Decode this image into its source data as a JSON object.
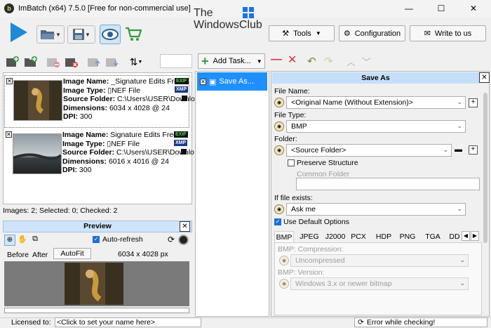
{
  "window": {
    "title": "ImBatch (x64) 7.5.0 [Free for non-commercial use]",
    "minimize": "—",
    "maximize": "☐",
    "close": "✕"
  },
  "watermark": {
    "line1": "The",
    "line2": "WindowsClub"
  },
  "toolbar": {
    "tools_label": "Tools",
    "configuration_label": "Configuration",
    "write_label": "Write to us"
  },
  "images": [
    {
      "name_label": "Image Name:",
      "name": "_Signature Edits Free",
      "type_label": "Image Type:",
      "type": "NEF File",
      "folder_label": "Source Folder:",
      "folder": "C:\\Users\\USER\\Downlo",
      "dim_label": "Dimensions:",
      "dim": "6034 x 4028 @ 24",
      "dpi_label": "DPI:",
      "dpi": "300"
    },
    {
      "name_label": "Image Name:",
      "name": "Signature Edits Free",
      "type_label": "Image Type:",
      "type": "NEF File",
      "folder_label": "Source Folder:",
      "folder": "C:\\Users\\USER\\Downlo",
      "dim_label": "Dimensions:",
      "dim": "6016 x 4016 @ 24",
      "dpi_label": "DPI:",
      "dpi": "300"
    }
  ],
  "badges": {
    "exif": "EXIF",
    "xmp": "XMP"
  },
  "status": "Images: 2; Selected: 0; Checked: 2",
  "preview": {
    "title": "Preview",
    "autorefresh": "Auto-refresh",
    "before": "Before",
    "after": "After",
    "autofit": "AutoFit",
    "size": "6034 x 4028 px"
  },
  "tasks": {
    "add_task": "Add Task...",
    "item": "Save As..."
  },
  "saveas": {
    "title": "Save As",
    "filename_label": "File Name:",
    "filename_value": "<Original Name (Without Extension)>",
    "filetype_label": "File Type:",
    "filetype_value": "BMP",
    "folder_label": "Folder:",
    "folder_value": "<Source Folder>",
    "preserve": "Preserve Structure",
    "common_folder": "Common Folder",
    "exists_label": "If file exists:",
    "exists_value": "Ask me",
    "default_options": "Use Default Options",
    "tabs": [
      "BMP",
      "JPEG",
      "J2000",
      "PCX",
      "HDP",
      "PNG",
      "TGA",
      "DD"
    ],
    "compression_label": "BMP: Compression:",
    "compression_value": "Uncompressed",
    "version_label": "BMP: Version:",
    "version_value": "Windows 3.x or newer bitmap"
  },
  "footer": {
    "licensed": "Licensed to:",
    "click_name": "<Click to set your name here>",
    "error": "Error while checking!"
  },
  "colors": {
    "accent": "#1e90ff",
    "header_bg": "#c5dff8",
    "preview_header": "#cfe4f9"
  }
}
